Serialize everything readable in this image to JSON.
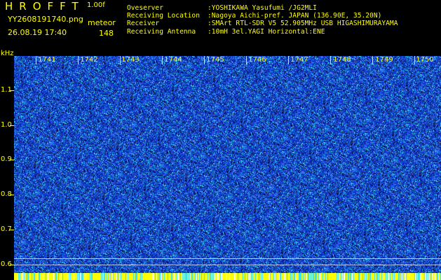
{
  "header": {
    "app_title": "HROFFT",
    "version": "1.00f",
    "filename": "YY2608191740.png",
    "datetime": "26.08.19 17:40",
    "meteor_label": "meteor",
    "meteor_count": "148"
  },
  "info": [
    {
      "label": "Oveserver",
      "value": ":YOSHIKAWA Yasufumi /JG2MLI"
    },
    {
      "label": "Receiving Location",
      "value": ":Nagoya Aichi-pref. JAPAN (136.90E, 35.20N)"
    },
    {
      "label": "Receiver",
      "value": ":SMArt RTL-SDR V5 52.905MHz USB HIGASHIMURAYAMA"
    },
    {
      "label": "Receiving Antenna",
      "value": ":10mH 3el.YAGI Horizontal:ENE"
    }
  ],
  "axis": {
    "y_unit": "kHz",
    "y_ticks": [
      "1.1",
      "1.0",
      "0.9",
      "0.8",
      "0.7",
      "0.6"
    ],
    "x_ticks": [
      "1741",
      "1742",
      "1743",
      "1744",
      "1745",
      "1746",
      "1747",
      "1748",
      "1749",
      "1750"
    ]
  },
  "colors": {
    "background": "#000000",
    "text": "#ffff00",
    "noise_base": "#1a2fc0",
    "noise_light": "#2fe0ff"
  }
}
